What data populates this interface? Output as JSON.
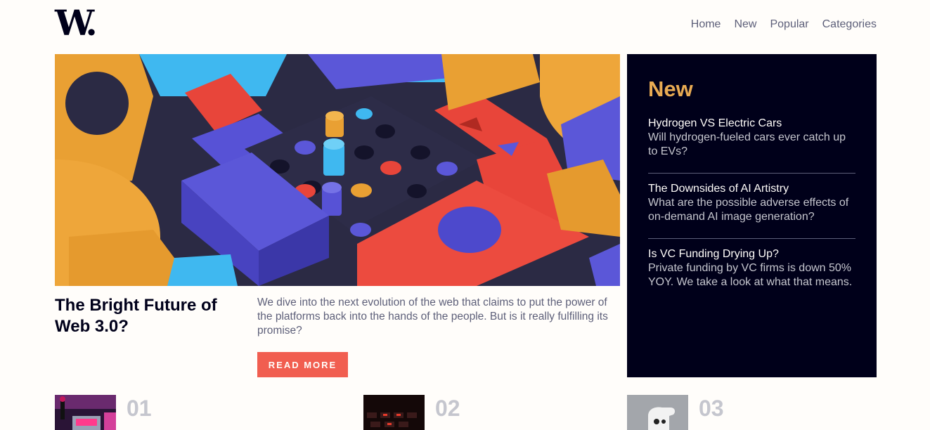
{
  "header": {
    "logo_text": "W.",
    "nav": [
      {
        "label": "Home"
      },
      {
        "label": "New"
      },
      {
        "label": "Popular"
      },
      {
        "label": "Categories"
      }
    ]
  },
  "hero": {
    "image_subject": "abstract 3D blocks and game-board pegs",
    "headline": "The Bright Future of Web 3.0?",
    "description": "We dive into the next evolution of the web that claims to put the power of the platforms back into the hands of the people. But is it really fulfilling its promise?",
    "cta_label": "READ MORE"
  },
  "new_section": {
    "title": "New",
    "items": [
      {
        "title": "Hydrogen VS Electric Cars",
        "summary": "Will hydrogen-fueled cars ever catch up to EVs?"
      },
      {
        "title": "The Downsides of AI Artistry",
        "summary": "What are the possible adverse effects of on-demand AI image generation?"
      },
      {
        "title": "Is VC Funding Drying Up?",
        "summary": "Private funding by VC firms is down 50% YOY. We take a look at what that means."
      }
    ]
  },
  "bottom_items": [
    {
      "number": "01"
    },
    {
      "number": "02"
    },
    {
      "number": "03"
    }
  ],
  "colors": {
    "background": "#fffdfa",
    "dark_navy": "#00001a",
    "accent_red": "#f15e50",
    "accent_orange": "#e9ab53",
    "muted_text": "#5d5f79",
    "light_gray": "#c5c6ce"
  }
}
